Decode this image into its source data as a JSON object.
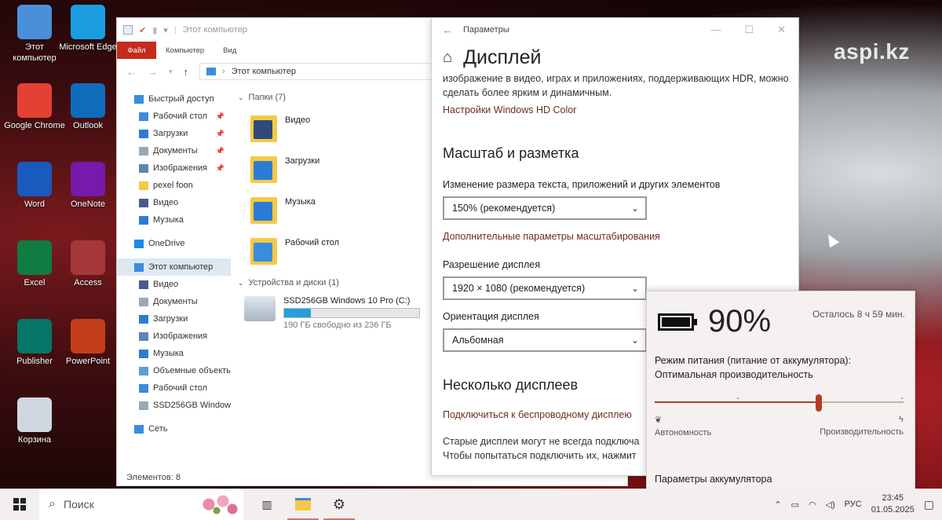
{
  "desktop": {
    "watermark": "aspi.kz",
    "icons": [
      {
        "label": "Этот компьютер",
        "icon": "this-pc-icon",
        "color": "#4a90d9"
      },
      {
        "label": "Microsoft Edge",
        "icon": "edge-icon",
        "color": "#1b9de2"
      },
      {
        "label": "Google Chrome",
        "icon": "chrome-icon",
        "color": "#e34133"
      },
      {
        "label": "Outlook",
        "icon": "outlook-icon",
        "color": "#0f6cbd"
      },
      {
        "label": "Word",
        "icon": "word-icon",
        "color": "#185abd"
      },
      {
        "label": "OneNote",
        "icon": "onenote-icon",
        "color": "#7719aa"
      },
      {
        "label": "Excel",
        "icon": "excel-icon",
        "color": "#107c41"
      },
      {
        "label": "Access",
        "icon": "access-icon",
        "color": "#a4373a"
      },
      {
        "label": "Publisher",
        "icon": "publisher-icon",
        "color": "#077568"
      },
      {
        "label": "PowerPoint",
        "icon": "powerpoint-icon",
        "color": "#c43e1c"
      },
      {
        "label": "Корзина",
        "icon": "recycle-bin-icon",
        "color": "#cfd8e0"
      }
    ]
  },
  "explorer": {
    "title": "Этот компьютер",
    "ribbon": {
      "file": "Файл",
      "computer": "Компьютер",
      "view": "Вид"
    },
    "address": "Этот компьютер",
    "nav": [
      {
        "label": "Быстрый доступ",
        "icon": "star-icon",
        "color": "#3a8dde",
        "pinned": false,
        "selected": false,
        "indent": 0
      },
      {
        "label": "Рабочий стол",
        "icon": "desktop-icon",
        "color": "#3a8dde",
        "pinned": true,
        "selected": false,
        "indent": 1
      },
      {
        "label": "Загрузки",
        "icon": "downloads-icon",
        "color": "#2c7cd6",
        "pinned": true,
        "selected": false,
        "indent": 1
      },
      {
        "label": "Документы",
        "icon": "documents-icon",
        "color": "#9aa8b4",
        "pinned": true,
        "selected": false,
        "indent": 1
      },
      {
        "label": "Изображения",
        "icon": "pictures-icon",
        "color": "#5f86b2",
        "pinned": true,
        "selected": false,
        "indent": 1
      },
      {
        "label": "pexel foon",
        "icon": "folder-icon",
        "color": "#f6c945",
        "pinned": false,
        "selected": false,
        "indent": 1
      },
      {
        "label": "Видео",
        "icon": "video-icon",
        "color": "#4b5a8a",
        "pinned": false,
        "selected": false,
        "indent": 1
      },
      {
        "label": "Музыка",
        "icon": "music-icon",
        "color": "#2c7cd6",
        "pinned": false,
        "selected": false,
        "indent": 1
      },
      {
        "label": "OneDrive",
        "icon": "onedrive-icon",
        "color": "#1e88e5",
        "pinned": false,
        "selected": false,
        "indent": 0
      },
      {
        "label": "Этот компьютер",
        "icon": "this-pc-icon",
        "color": "#3a8dde",
        "pinned": false,
        "selected": true,
        "indent": 0
      },
      {
        "label": "Видео",
        "icon": "video-icon",
        "color": "#4b5a8a",
        "pinned": false,
        "selected": false,
        "indent": 1
      },
      {
        "label": "Документы",
        "icon": "documents-icon",
        "color": "#9aa8b4",
        "pinned": false,
        "selected": false,
        "indent": 1
      },
      {
        "label": "Загрузки",
        "icon": "downloads-icon",
        "color": "#2c7cd6",
        "pinned": false,
        "selected": false,
        "indent": 1
      },
      {
        "label": "Изображения",
        "icon": "pictures-icon",
        "color": "#5f86b2",
        "pinned": false,
        "selected": false,
        "indent": 1
      },
      {
        "label": "Музыка",
        "icon": "music-icon",
        "color": "#2c7cd6",
        "pinned": false,
        "selected": false,
        "indent": 1
      },
      {
        "label": "Объемные объекты",
        "icon": "3d-objects-icon",
        "color": "#5aa0d8",
        "pinned": false,
        "selected": false,
        "indent": 1
      },
      {
        "label": "Рабочий стол",
        "icon": "desktop-icon",
        "color": "#3a8dde",
        "pinned": false,
        "selected": false,
        "indent": 1
      },
      {
        "label": "SSD256GB Window",
        "icon": "drive-icon",
        "color": "#9aa8b4",
        "pinned": false,
        "selected": false,
        "indent": 1
      },
      {
        "label": "Сеть",
        "icon": "network-icon",
        "color": "#3a8dde",
        "pinned": false,
        "selected": false,
        "indent": 0
      }
    ],
    "folders_header": "Папки (7)",
    "folders": [
      {
        "name": "Видео",
        "icon": "video-folder-icon",
        "overlay": "#2e4a7a"
      },
      {
        "name": "Загрузки",
        "icon": "downloads-folder-icon",
        "overlay": "#2c7cd6"
      },
      {
        "name": "Музыка",
        "icon": "music-folder-icon",
        "overlay": "#2c7cd6"
      },
      {
        "name": "Рабочий стол",
        "icon": "desktop-folder-icon",
        "overlay": "#3a8dde"
      }
    ],
    "devices_header": "Устройства и диски (1)",
    "drive": {
      "name": "SSD256GB Windows 10 Pro (C:)",
      "free": "190 ГБ свободно из 236 ГБ",
      "used_fraction": 0.195
    },
    "status": "Элементов: 8"
  },
  "settings": {
    "title": "Параметры",
    "heading": "Дисплей",
    "desc": "изображение в видео, играх и приложениях, поддерживающих HDR, можно сделать более ярким и динамичным.",
    "hd_link": "Настройки Windows HD Color",
    "scale_heading": "Масштаб и разметка",
    "scale_label": "Изменение размера текста, приложений и других элементов",
    "scale_value": "150% (рекомендуется)",
    "advanced_link": "Дополнительные параметры масштабирования",
    "resolution_label": "Разрешение дисплея",
    "resolution_value": "1920 × 1080 (рекомендуется)",
    "orientation_label": "Ориентация дисплея",
    "orientation_value": "Альбомная",
    "multi_heading": "Несколько дисплеев",
    "wireless_link": "Подключиться к беспроводному дисплею",
    "old_displays_1": "Старые дисплеи могут не всегда подключа",
    "old_displays_2": "Чтобы попытаться подключить их, нажмит"
  },
  "battery": {
    "percent": "90%",
    "remaining": "Осталось 8 ч 59 мин.",
    "mode_label": "Режим питания (питание от аккумулятора):",
    "mode_value": "Оптимальная производительность",
    "slider_level": 0.66,
    "left_label": "Автономность",
    "right_label": "Производительность",
    "settings_link": "Параметры аккумулятора"
  },
  "taskbar": {
    "search_placeholder": "Поиск",
    "language": "РУС",
    "time": "23:45",
    "date": "01.05.2025"
  }
}
